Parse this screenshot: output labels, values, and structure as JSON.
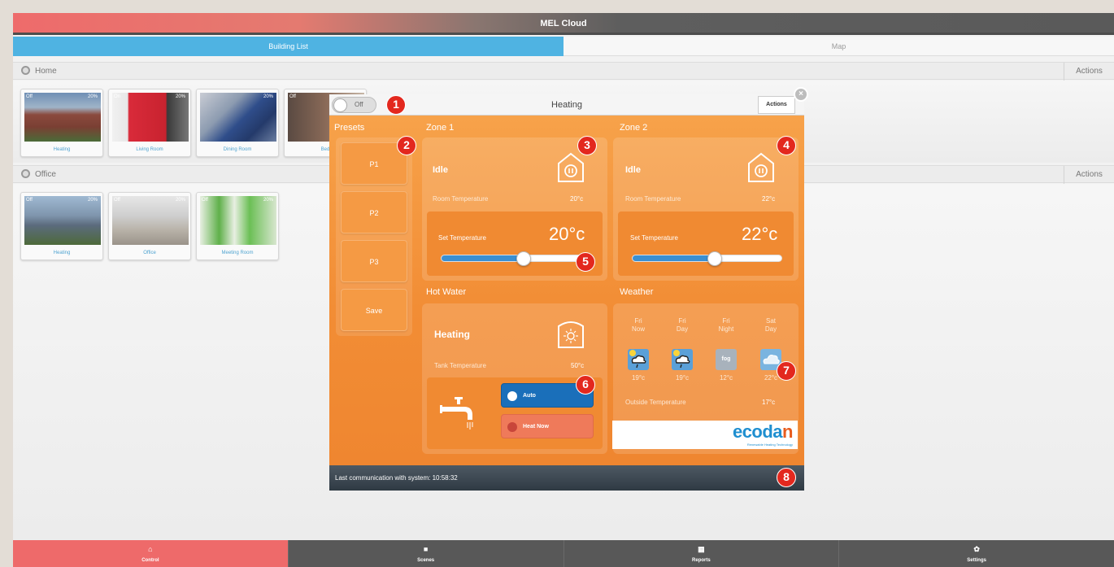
{
  "app": {
    "title": "MEL Cloud"
  },
  "top_tabs": [
    {
      "label": "Building List"
    },
    {
      "label": "Map"
    }
  ],
  "buildings": [
    {
      "name": "Home",
      "actions_label": "Actions",
      "units": [
        {
          "name": "Heating",
          "status": "Off",
          "level": "20%"
        },
        {
          "name": "Living Room",
          "status": "On",
          "level": "20%"
        },
        {
          "name": "Dining Room",
          "status": "",
          "level": "20%"
        },
        {
          "name": "Bed",
          "status": "Off",
          "level": ""
        }
      ]
    },
    {
      "name": "Office",
      "actions_label": "Actions",
      "units": [
        {
          "name": "Heating",
          "status": "Off",
          "level": "20%"
        },
        {
          "name": "Office",
          "status": "Off",
          "level": "20%"
        },
        {
          "name": "Meeting Room",
          "status": "Off",
          "level": "20%"
        }
      ]
    }
  ],
  "dialog": {
    "toggle_label": "Off",
    "title": "Heating",
    "actions_label": "Actions",
    "close_label": "×",
    "presets": {
      "title": "Presets",
      "buttons": [
        "P1",
        "P2",
        "P3",
        "Save"
      ]
    },
    "zone1": {
      "title": "Zone 1",
      "status": "Idle",
      "room_temp_label": "Room Temperature",
      "room_temp": "20°c",
      "set_temp_label": "Set Temperature",
      "set_temp": "20°c",
      "set_level": 0.55
    },
    "zone2": {
      "title": "Zone 2",
      "status": "Idle",
      "room_temp_label": "Room Temperature",
      "room_temp": "22°c",
      "set_temp_label": "Set Temperature",
      "set_temp": "22°c",
      "set_level": 0.55
    },
    "hot_water": {
      "title": "Hot Water",
      "status": "Heating",
      "tank_temp_label": "Tank Temperature",
      "tank_temp": "50°c",
      "auto_label": "Auto",
      "heat_now_label": "Heat Now"
    },
    "weather": {
      "title": "Weather",
      "columns": [
        {
          "day": "Fri",
          "period": "Now",
          "temp": "19°c",
          "icon": "rain-cloud-icon"
        },
        {
          "day": "Fri",
          "period": "Day",
          "temp": "19°c",
          "icon": "rain-cloud-icon"
        },
        {
          "day": "Fri",
          "period": "Night",
          "temp": "12°c",
          "icon": "fog-icon",
          "icon_text": "fog"
        },
        {
          "day": "Sat",
          "period": "Day",
          "temp": "22°c",
          "icon": "cloud-icon"
        }
      ],
      "outside_label": "Outside Temperature",
      "outside_temp": "17°c"
    },
    "brand": {
      "logo_main": "ecoda",
      "logo_end": "n",
      "tagline": "Renewable Heating Technology"
    },
    "footer": "Last communication with system: 10:58:32"
  },
  "markers": [
    "1",
    "2",
    "3",
    "4",
    "5",
    "6",
    "7",
    "8"
  ],
  "bottom_nav": [
    {
      "label": "Control",
      "icon": "home-icon",
      "glyph": "⌂"
    },
    {
      "label": "Scenes",
      "icon": "camera-icon",
      "glyph": "■"
    },
    {
      "label": "Reports",
      "icon": "grid-icon",
      "glyph": "▦"
    },
    {
      "label": "Settings",
      "icon": "gear-icon",
      "glyph": "✿"
    }
  ],
  "colors": {
    "accent_red": "#ee6a6a",
    "accent_blue": "#4fb3e2",
    "dialog_orange": "#f28d35",
    "marker_red": "#e3281e"
  }
}
